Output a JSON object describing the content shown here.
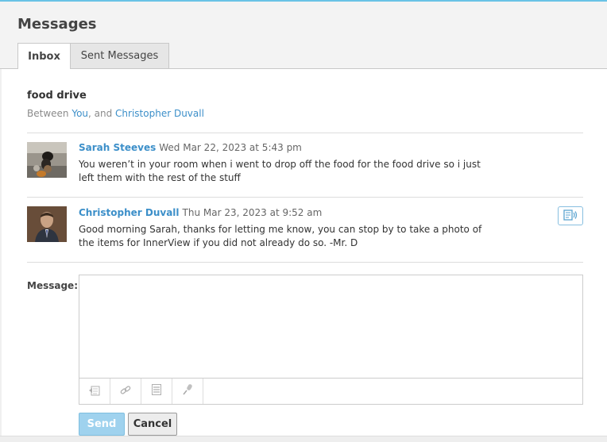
{
  "header": {
    "title": "Messages",
    "tabs": [
      {
        "label": "Inbox",
        "active": true
      },
      {
        "label": "Sent Messages",
        "active": false
      }
    ]
  },
  "thread": {
    "subject": "food drive",
    "between_prefix": "Between ",
    "participant_you": "You",
    "separator": ", and ",
    "participant_other": "Christopher Duvall"
  },
  "messages": [
    {
      "author": "Sarah Steeves",
      "timestamp": "Wed Mar 22, 2023 at 5:43 pm",
      "body": "You weren’t in your room when i went to drop off the food for the food drive so i just left them with the rest of the stuff",
      "avatar_icon": "dog-photo-avatar"
    },
    {
      "author": "Christopher Duvall",
      "timestamp": "Thu Mar 23, 2023 at 9:52 am",
      "body": "Good morning Sarah, thanks for letting me know, you can stop by to take a photo of the items for InnerView if you did not already do so. -Mr. D",
      "avatar_icon": "person-photo-avatar"
    }
  ],
  "compose": {
    "label": "Message:",
    "value": "",
    "toolbar_icons": [
      "attach-file-icon",
      "link-icon",
      "document-icon",
      "microphone-icon"
    ],
    "send_label": "Send",
    "cancel_label": "Cancel"
  },
  "colors": {
    "accent": "#3c8fc9",
    "top_border": "#69c3e6",
    "send_button": "#9fd2ee"
  }
}
